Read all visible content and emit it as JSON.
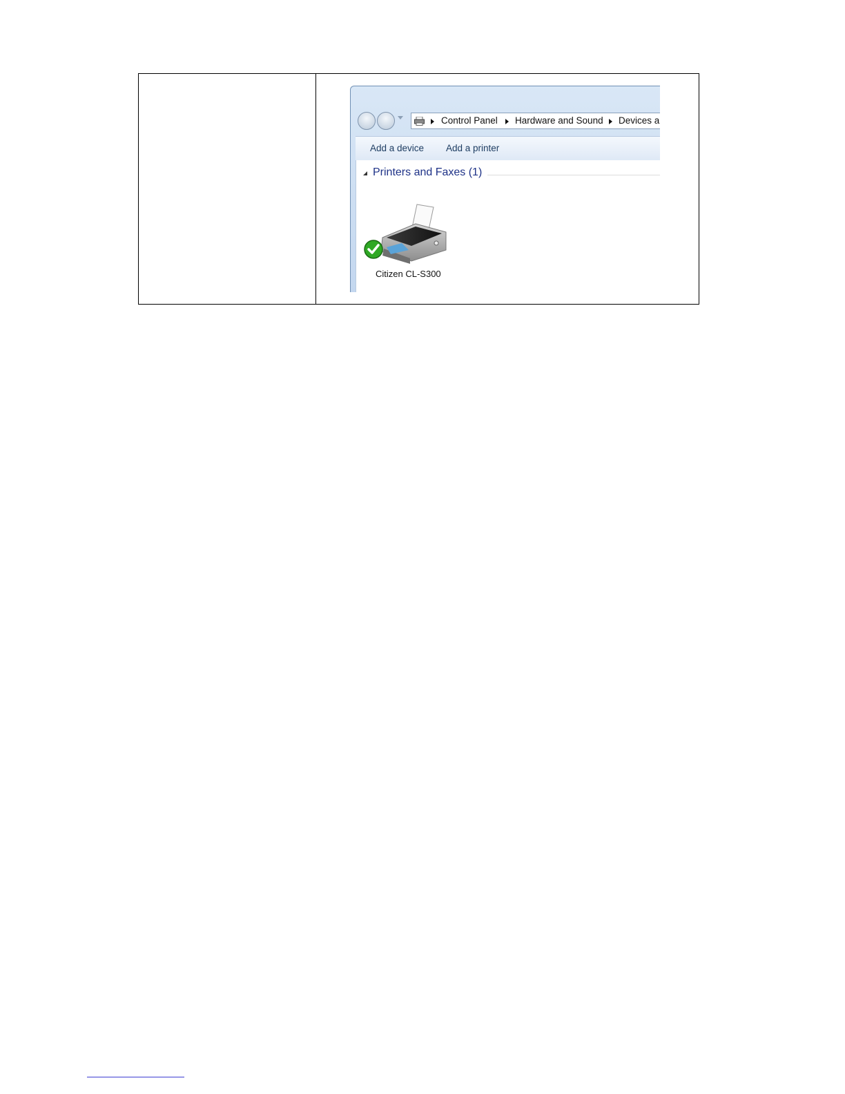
{
  "breadcrumb": {
    "items": [
      "Control Panel",
      "Hardware and Sound",
      "Devices an"
    ]
  },
  "toolbar": {
    "add_device_label": "Add a device",
    "add_printer_label": "Add a printer"
  },
  "group": {
    "title": "Printers and Faxes (1)"
  },
  "device": {
    "name": "Citizen CL-S300",
    "status": "default-printer",
    "icon": "printer-icon"
  },
  "colors": {
    "group_title": "#1e3287",
    "toolbar_text": "#1e3d62",
    "check": "#2fa824"
  }
}
